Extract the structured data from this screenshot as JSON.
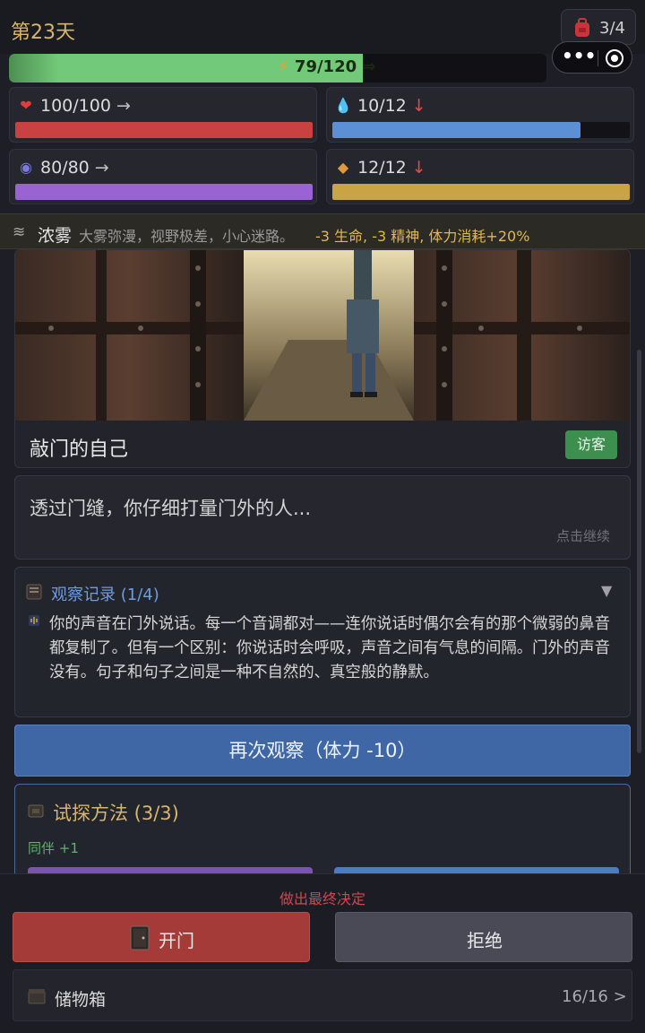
{
  "header": {
    "day": "第23天",
    "bag": {
      "icon": "backpack-icon",
      "count": "3/4"
    },
    "capsule": {
      "more": "•••",
      "close_icon": "target-icon"
    }
  },
  "stamina": {
    "icon": "lightning-icon",
    "text": "79/120 ⇒",
    "value": 79,
    "max": 120,
    "color": "#72c979"
  },
  "stats": [
    {
      "name": "health",
      "icon": "heart-icon",
      "glyph": "❤",
      "glyph_color": "#e03c3c",
      "value": "100/100",
      "trend": "→",
      "trend_type": "flat",
      "fraction": 1.0,
      "color": "#c94141"
    },
    {
      "name": "water",
      "icon": "water-drop-icon",
      "glyph": "💧",
      "glyph_color": "#4aa8e8",
      "value": "10/12",
      "trend": "↓",
      "trend_type": "down",
      "fraction": 0.8333,
      "color": "#5b8fd6"
    },
    {
      "name": "spirit",
      "icon": "brain-icon",
      "glyph": "◉",
      "glyph_color": "#7a7ae0",
      "value": "80/80",
      "trend": "→",
      "trend_type": "flat",
      "fraction": 1.0,
      "color": "#9a63d4"
    },
    {
      "name": "food",
      "icon": "bread-icon",
      "glyph": "◆",
      "glyph_color": "#e09a3a",
      "value": "12/12",
      "trend": "↓",
      "trend_type": "down",
      "fraction": 1.0,
      "color": "#c9a445"
    }
  ],
  "weather": {
    "icon": "fog-icon",
    "name": "浓雾",
    "description": "大雾弥漫，视野极差，小心迷路。",
    "effect": "-3 生命, -3 精神, 体力消耗+20%"
  },
  "scene": {
    "visitor_name": "敲门的自己",
    "visitor_tag": "访客"
  },
  "dialog": {
    "text": "透过门缝，你仔细打量门外的人...",
    "hint": "点击继续"
  },
  "observation": {
    "title": "观察记录 (1/4)",
    "toggle": "▼",
    "entries": [
      "你的声音在门外说话。每一个音调都对——连你说话时偶尔会有的那个微弱的鼻音都复制了。但有一个区别：你说话时会呼吸，声音之间有气息的间隔。门外的声音没有。句子和句子之间是一种不自然的、真空般的静默。"
    ]
  },
  "observe_again": {
    "label": "再次观察（体力 -10）"
  },
  "methods": {
    "title": "试探方法 (3/3)",
    "bonus": "同伴 +1"
  },
  "decision": {
    "label": "做出最终决定",
    "open_label": "开门",
    "refuse_label": "拒绝"
  },
  "storage": {
    "label": "储物箱",
    "count": "16/16 >"
  },
  "colors": {
    "accent_gold": "#d8b56e",
    "accent_blue": "#3f67a6",
    "danger": "#a43b38"
  }
}
